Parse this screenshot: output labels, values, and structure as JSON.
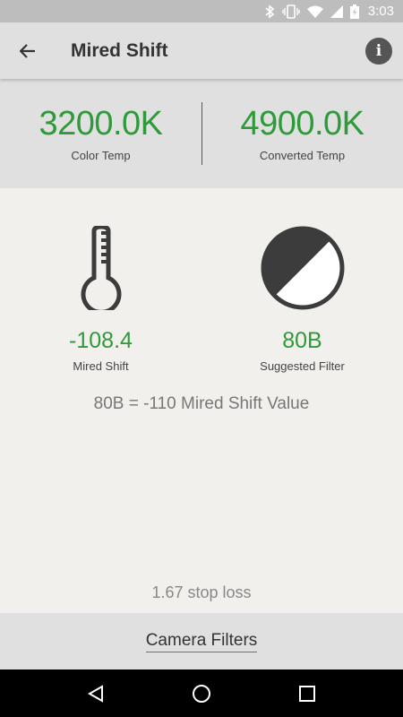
{
  "status_bar": {
    "time": "3:03",
    "icons": [
      "bluetooth-icon",
      "vibrate-icon",
      "wifi-icon",
      "signal-icon",
      "battery-charging-icon"
    ]
  },
  "toolbar": {
    "title": "Mired Shift",
    "back_icon": "arrow-back-icon",
    "info_icon": "info-icon"
  },
  "temps": {
    "color_temp_value": "3200.0K",
    "color_temp_label": "Color Temp",
    "converted_temp_value": "4900.0K",
    "converted_temp_label": "Converted Temp"
  },
  "result": {
    "mired_value": "-108.4",
    "mired_label": "Mired Shift",
    "filter_value": "80B",
    "filter_label": "Suggested Filter",
    "explanation": "80B = -110 Mired Shift Value",
    "stop_loss": "1.67 stop loss"
  },
  "bottom": {
    "camera_filters_label": "Camera Filters"
  },
  "nav": {
    "icons": [
      "back-triangle-icon",
      "home-circle-icon",
      "recents-square-icon"
    ]
  },
  "colors": {
    "accent": "#2e9a3a",
    "toolbar_bg": "#e0e0e0",
    "content_bg": "#f2f0ed"
  }
}
